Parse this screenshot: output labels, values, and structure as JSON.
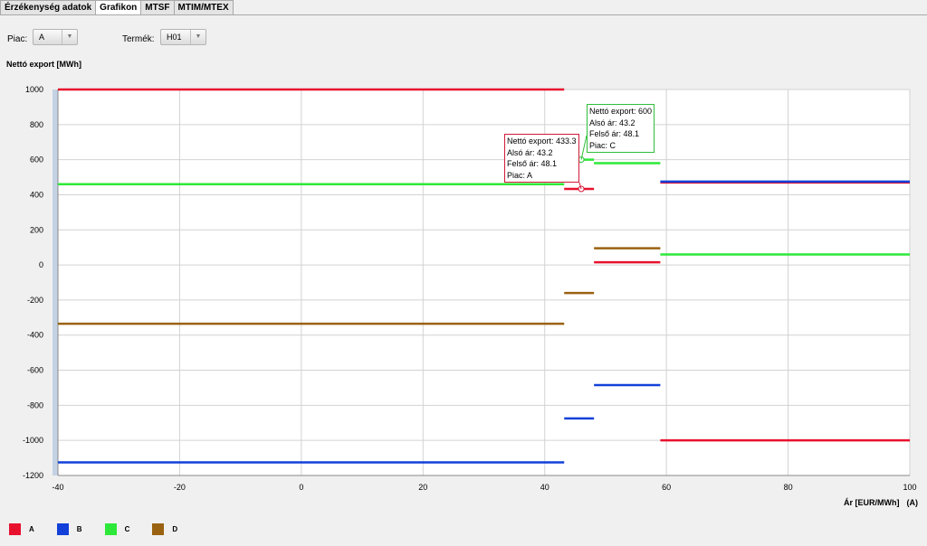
{
  "tabs": [
    "Érzékenység adatok",
    "Grafikon",
    "MTSF",
    "MTIM/MTEX"
  ],
  "active_tab": 1,
  "filters": {
    "market_label": "Piac:",
    "market_value": "A",
    "product_label": "Termék:",
    "product_value": "H01"
  },
  "chart_data": {
    "type": "line",
    "ylabel": "Nettó export [MWh]",
    "xlabel": "Ár [EUR/MWh]",
    "xlabel_suffix": "(A)",
    "xlim": [
      -40,
      100
    ],
    "ylim": [
      -1200,
      1000
    ],
    "xticks": [
      -40,
      -20,
      0,
      20,
      40,
      60,
      80,
      100
    ],
    "yticks": [
      1000,
      800,
      600,
      400,
      200,
      0,
      -200,
      -400,
      -600,
      -800,
      -1000,
      -1200
    ],
    "grid": true,
    "legend_position": "bottom-left",
    "series": [
      {
        "name": "A",
        "color": "#e8112d",
        "segments": [
          {
            "x": [
              -40,
              43.2
            ],
            "y": 1000
          },
          {
            "x": [
              43.2,
              48.1
            ],
            "y": 433.3
          },
          {
            "x": [
              48.1,
              59
            ],
            "y": 15
          },
          {
            "x": [
              59,
              100
            ],
            "y": 470
          },
          {
            "x": [
              59,
              100
            ],
            "y": -1000
          }
        ]
      },
      {
        "name": "B",
        "color": "#1240d9",
        "segments": [
          {
            "x": [
              -40,
              43.2
            ],
            "y": -1125
          },
          {
            "x": [
              43.2,
              48.1
            ],
            "y": -875
          },
          {
            "x": [
              48.1,
              59
            ],
            "y": -685
          },
          {
            "x": [
              59,
              100
            ],
            "y": 475
          }
        ]
      },
      {
        "name": "C",
        "color": "#2de838",
        "segments": [
          {
            "x": [
              -40,
              43.2
            ],
            "y": 460
          },
          {
            "x": [
              43.2,
              48.1
            ],
            "y": 600
          },
          {
            "x": [
              48.1,
              59
            ],
            "y": 580
          },
          {
            "x": [
              59,
              100
            ],
            "y": 60
          }
        ]
      },
      {
        "name": "D",
        "color": "#9a6210",
        "segments": [
          {
            "x": [
              -40,
              43.2
            ],
            "y": -335
          },
          {
            "x": [
              43.2,
              48.1
            ],
            "y": -160
          },
          {
            "x": [
              48.1,
              59
            ],
            "y": 95
          }
        ]
      }
    ],
    "tooltips": [
      {
        "color": "#d11a3a",
        "series": "A",
        "x": 46,
        "y": 433.3,
        "lines": [
          "Nettó export: 433.3",
          "Alsó ár: 43.2",
          "Felső ár: 48.1",
          "Piac: A"
        ]
      },
      {
        "color": "#2fbf3a",
        "series": "C",
        "x": 46,
        "y": 600,
        "lines": [
          "Nettó export: 600",
          "Alsó ár: 43.2",
          "Felső ár: 48.1",
          "Piac: C"
        ]
      }
    ]
  }
}
